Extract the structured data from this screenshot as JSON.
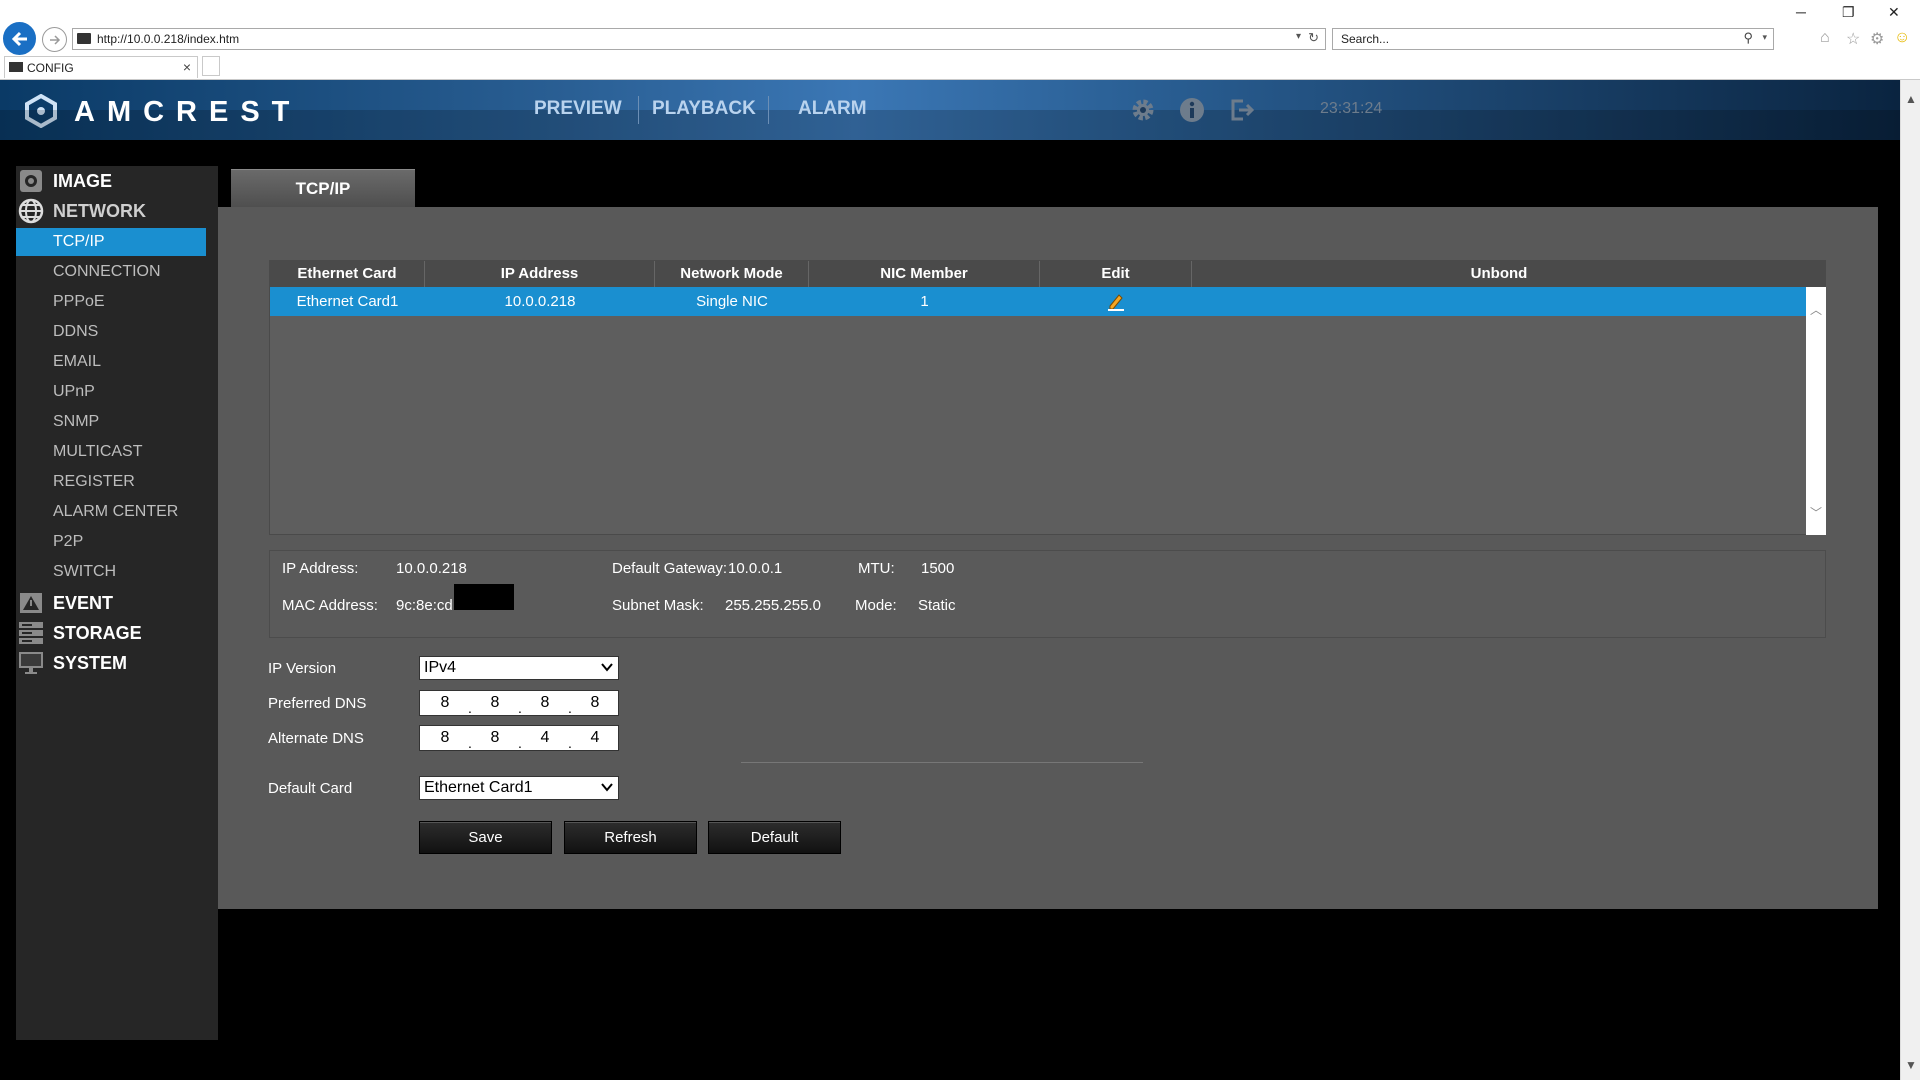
{
  "browser": {
    "url": "http://10.0.0.218/index.htm",
    "search_placeholder": "Search...",
    "tab_title": "CONFIG"
  },
  "header": {
    "brand": "AMCREST",
    "nav": [
      "PREVIEW",
      "PLAYBACK",
      "ALARM"
    ],
    "clock": "23:31:24",
    "icons": [
      "gear-icon",
      "info-icon",
      "logout-icon"
    ]
  },
  "sidebar": {
    "categories": {
      "image": "IMAGE",
      "network": "NETWORK",
      "event": "EVENT",
      "storage": "STORAGE",
      "system": "SYSTEM"
    },
    "network_items": [
      "TCP/IP",
      "CONNECTION",
      "PPPoE",
      "DDNS",
      "EMAIL",
      "UPnP",
      "SNMP",
      "MULTICAST",
      "REGISTER",
      "ALARM CENTER",
      "P2P",
      "SWITCH"
    ],
    "active_item": "TCP/IP"
  },
  "page": {
    "tab_label": "TCP/IP",
    "table": {
      "columns": [
        "Ethernet Card",
        "IP Address",
        "Network Mode",
        "NIC Member",
        "Edit",
        "Unbond"
      ],
      "rows": [
        {
          "card": "Ethernet Card1",
          "ip": "10.0.0.218",
          "mode": "Single NIC",
          "member": "1"
        }
      ]
    },
    "info": {
      "ip_label": "IP Address:",
      "ip_value": "10.0.0.218",
      "gateway_label": "Default Gateway:",
      "gateway_value": "10.0.0.1",
      "mtu_label": "MTU:",
      "mtu_value": "1500",
      "mac_label": "MAC Address:",
      "mac_value": "9c:8e:cd",
      "subnet_label": "Subnet Mask:",
      "subnet_value": "255.255.255.0",
      "mode_label": "Mode:",
      "mode_value": "Static"
    },
    "form": {
      "ip_version_label": "IP Version",
      "ip_version_value": "IPv4",
      "preferred_dns_label": "Preferred DNS",
      "preferred_dns": [
        "8",
        "8",
        "8",
        "8"
      ],
      "alternate_dns_label": "Alternate DNS",
      "alternate_dns": [
        "8",
        "8",
        "4",
        "4"
      ],
      "default_card_label": "Default Card",
      "default_card_value": "Ethernet Card1"
    },
    "buttons": {
      "save": "Save",
      "refresh": "Refresh",
      "default": "Default"
    }
  },
  "colors": {
    "accent": "#1a8fd0",
    "content_bg": "#595959",
    "sidebar_bg": "#262626"
  }
}
